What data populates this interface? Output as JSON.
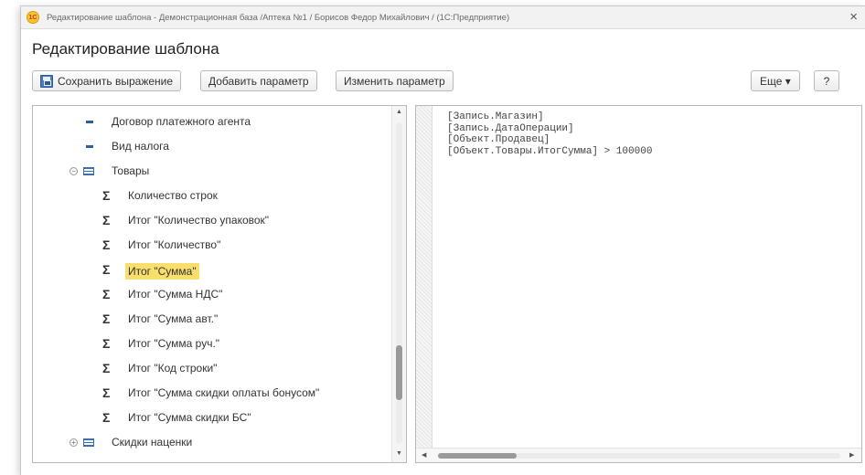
{
  "window": {
    "title": "Редактирование шаблона - Демонстрационная база /Аптека №1 / Борисов Федор Михайлович / (1С:Предприятие)",
    "logo_text": "1С",
    "close_glyph": "×",
    "heading": "Редактирование шаблона"
  },
  "toolbar": {
    "save_label": "Сохранить выражение",
    "add_param_label": "Добавить параметр",
    "edit_param_label": "Изменить параметр",
    "more_label": "Еще ▾",
    "help_label": "?"
  },
  "tree": {
    "items": [
      {
        "icon": "requisite-dash-icon",
        "label": "Договор платежного агента",
        "level": 1
      },
      {
        "icon": "requisite-dash-icon",
        "label": "Вид налога",
        "level": 1
      },
      {
        "icon": "table-icon",
        "label": "Товары",
        "level": 0,
        "expanded": true
      },
      {
        "icon": "sigma-icon",
        "label": "Количество строк",
        "level": 2
      },
      {
        "icon": "sigma-icon",
        "label": "Итог \"Количество упаковок\"",
        "level": 2
      },
      {
        "icon": "sigma-icon",
        "label": "Итог \"Количество\"",
        "level": 2
      },
      {
        "icon": "sigma-icon",
        "label": "Итог \"Сумма\"",
        "level": 2,
        "selected": true
      },
      {
        "icon": "sigma-icon",
        "label": "Итог \"Сумма НДС\"",
        "level": 2
      },
      {
        "icon": "sigma-icon",
        "label": "Итог \"Сумма авт.\"",
        "level": 2
      },
      {
        "icon": "sigma-icon",
        "label": "Итог \"Сумма руч.\"",
        "level": 2
      },
      {
        "icon": "sigma-icon",
        "label": "Итог \"Код строки\"",
        "level": 2
      },
      {
        "icon": "sigma-icon",
        "label": "Итог \"Сумма скидки оплаты бонусом\"",
        "level": 2
      },
      {
        "icon": "sigma-icon",
        "label": "Итог \"Сумма скидки БС\"",
        "level": 2
      },
      {
        "icon": "table-icon",
        "label": "Скидки наценки",
        "level": 0,
        "expanded": false
      }
    ]
  },
  "editor": {
    "lines": [
      "[Запись.Магазин]",
      "[Запись.ДатаОперации]",
      "[Объект.Продавец]",
      "[Объект.Товары.ИтогСумма] > 100000"
    ]
  },
  "colors": {
    "selection": "#f9de6b",
    "accent": "#2c5ea8"
  }
}
